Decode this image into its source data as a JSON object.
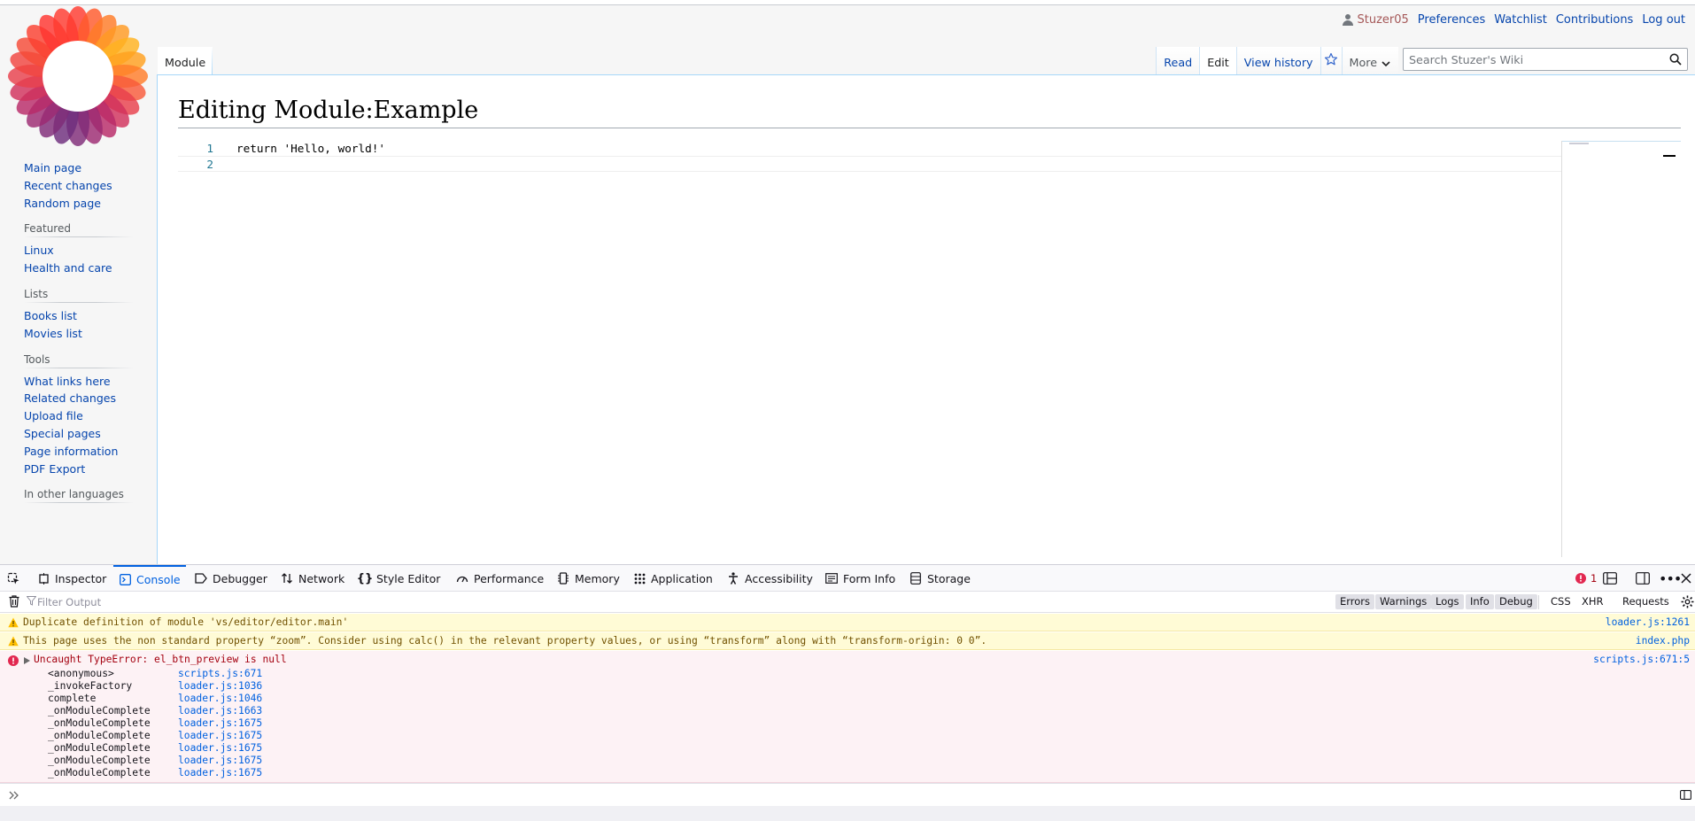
{
  "personal": {
    "username": "Stuzer05",
    "preferences": "Preferences",
    "watchlist": "Watchlist",
    "contributions": "Contributions",
    "logout": "Log out"
  },
  "sidebar": {
    "navigation": [
      "Main page",
      "Recent changes",
      "Random page"
    ],
    "featured": {
      "heading": "Featured",
      "items": [
        "Linux",
        "Health and care"
      ]
    },
    "lists": {
      "heading": "Lists",
      "items": [
        "Books list",
        "Movies list"
      ]
    },
    "tools": {
      "heading": "Tools",
      "items": [
        "What links here",
        "Related changes",
        "Upload file",
        "Special pages",
        "Page information",
        "PDF Export"
      ]
    },
    "languages": {
      "heading": "In other languages"
    }
  },
  "tabs": {
    "namespace": "Module",
    "read": "Read",
    "edit": "Edit",
    "history": "View history",
    "more": "More"
  },
  "search": {
    "placeholder": "Search Stuzer's Wiki"
  },
  "page": {
    "title": "Editing Module:Example"
  },
  "editor": {
    "lines": [
      {
        "num": "1",
        "text": "return 'Hello, world!'"
      },
      {
        "num": "2",
        "text": ""
      }
    ]
  },
  "devtools": {
    "tabs": [
      "Inspector",
      "Console",
      "Debugger",
      "Network",
      "Style Editor",
      "Performance",
      "Memory",
      "Application",
      "Accessibility",
      "Form Info",
      "Storage"
    ],
    "active_tab": "Console",
    "error_count": "1",
    "filter_placeholder": "Filter Output",
    "filters": [
      "Errors",
      "Warnings",
      "Logs",
      "Info",
      "Debug",
      "CSS",
      "XHR",
      "Requests"
    ],
    "messages": [
      {
        "level": "warning",
        "text": "Duplicate definition of module 'vs/editor/editor.main'",
        "source": "loader.js:1261"
      },
      {
        "level": "warning",
        "text": "This page uses the non standard property “zoom”. Consider using calc() in the relevant property values, or using “transform” along with “transform-origin: 0 0”.",
        "source": "index.php"
      },
      {
        "level": "error",
        "text": "Uncaught TypeError: el_btn_preview is null",
        "source": "scripts.js:671:5"
      }
    ],
    "stack": [
      {
        "fn": "<anonymous>",
        "loc": "scripts.js:671"
      },
      {
        "fn": "_invokeFactory",
        "loc": "loader.js:1036"
      },
      {
        "fn": "complete",
        "loc": "loader.js:1046"
      },
      {
        "fn": "_onModuleComplete",
        "loc": "loader.js:1663"
      },
      {
        "fn": "_onModuleComplete",
        "loc": "loader.js:1675"
      },
      {
        "fn": "_onModuleComplete",
        "loc": "loader.js:1675"
      },
      {
        "fn": "_onModuleComplete",
        "loc": "loader.js:1675"
      },
      {
        "fn": "_onModuleComplete",
        "loc": "loader.js:1675"
      },
      {
        "fn": "_onModuleComplete",
        "loc": "loader.js:1675"
      }
    ]
  },
  "colors": {
    "link": "#0645ad",
    "user": "#a55858",
    "devtools_accent": "#0061e0",
    "error": "#a4000f",
    "warning": "#715100"
  },
  "icons": [
    "user-icon",
    "wiki-logo-icon",
    "watch-star-icon",
    "chevron-down-icon",
    "search-icon",
    "pick-element-icon",
    "trash-icon",
    "filter-icon",
    "warning-icon",
    "error-icon",
    "expand-arrow-icon",
    "console-prompt-icon",
    "gear-icon",
    "close-icon",
    "more-icon",
    "dock-icon",
    "split-console-icon"
  ]
}
